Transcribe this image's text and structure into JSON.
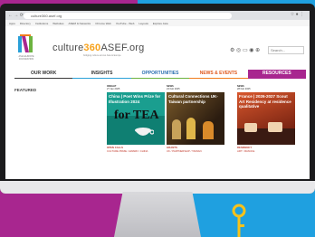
{
  "browser": {
    "url": "culture360.asef.org",
    "bookmarks": [
      "Apps",
      "Directory",
      "Institutions",
      "Websites",
      "ASEM & Networks",
      "Chrome Web",
      "YouTube - Web",
      "Layouts",
      "Explore Asia"
    ]
  },
  "site": {
    "brand_first": "culture",
    "brand_num": "360",
    "brand_dot": "ASEF",
    "brand_tld": ".org",
    "logo_caption": "ASIA-EUROPE FOUNDATION",
    "tagline": "bridging culture across Asia & Europe",
    "search_placeholder": "Search..."
  },
  "nav": {
    "work": "OUR WORK",
    "insights": "INSIGHTS",
    "opportunities": "OPPORTUNITIES",
    "news": "NEWS & EVENTS",
    "resources": "RESOURCES"
  },
  "featured_label": "FEATURED",
  "cards": [
    {
      "meta1": "INSIGHT",
      "meta2": "27 Jan 2025",
      "title": "China | Poet Wins Prize for Illustration 2024",
      "overlay": "for TEA",
      "tag1": "OPEN CALLS",
      "tag2": "CULTURE PRIZE / AWARD / CHINA"
    },
    {
      "meta1": "NEWS",
      "meta2": "24 Feb 2025",
      "title": "Cultural Connections UK-Taiwan partnership",
      "tag1": "GRANTS",
      "tag2": "UK / PARTNERSHIP / TAIWAN"
    },
    {
      "meta1": "NEWS",
      "meta2": "28 Feb 2025",
      "title": "France | 2026-2027 Scout Art Residency at residence qualitative",
      "tag1": "RESIDENCY",
      "tag2": "ART / FRANCE"
    }
  ],
  "colors": {
    "magenta": "#a8268f",
    "cyan": "#1fa0e0",
    "orange": "#f07c1c",
    "green": "#6cb33f",
    "teal_card": "#1a9e8f"
  }
}
